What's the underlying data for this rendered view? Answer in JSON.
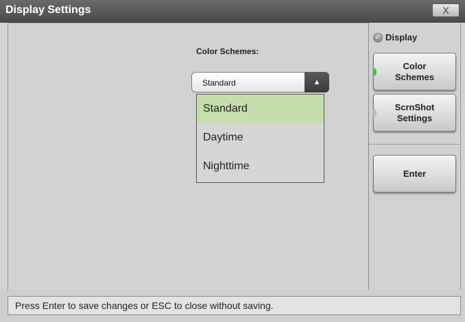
{
  "window": {
    "title": "Display Settings",
    "close_label": "X"
  },
  "main": {
    "color_schemes_label": "Color Schemes:",
    "select": {
      "selected_value": "Standard",
      "arrow_icon": "triangle-up-icon",
      "options": [
        "Standard",
        "Daytime",
        "Nighttime"
      ],
      "selected_index": 0
    }
  },
  "sidebar": {
    "radio_label": "Display",
    "buttons": [
      {
        "label": "Color\nSchemes",
        "indicator_color": "#3cc43c"
      },
      {
        "label": "ScrnShot\nSettings",
        "indicator_color": "#bbbbbb"
      },
      {
        "label": "Enter"
      }
    ]
  },
  "status": {
    "message": "Press Enter to save changes or ESC to close without saving."
  },
  "colors": {
    "title_bar": "#5a5a5a",
    "panel": "#d2d2d2",
    "selected_option": "#c5deab",
    "active_indicator": "#3cc43c"
  }
}
